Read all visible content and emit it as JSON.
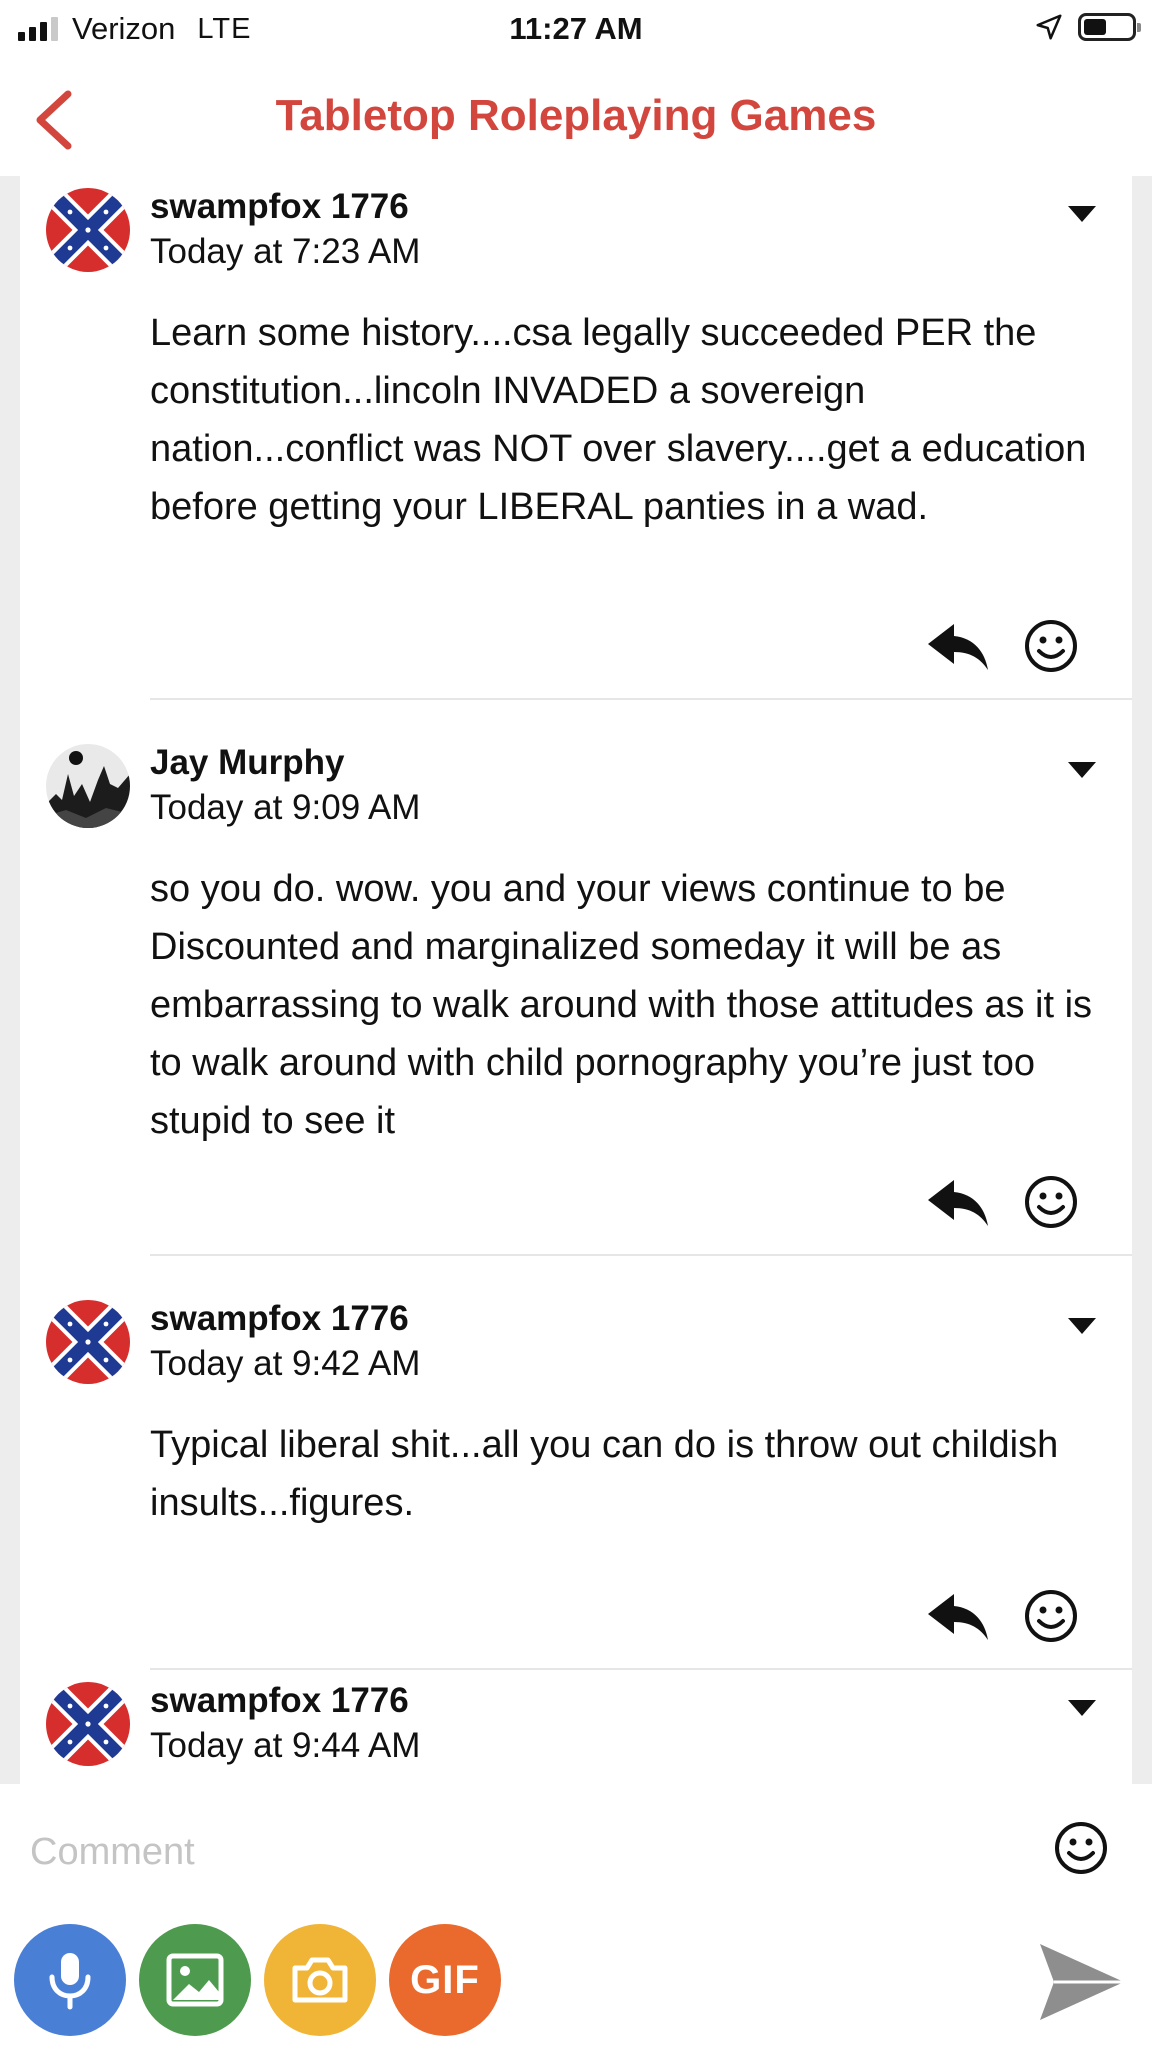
{
  "status_bar": {
    "carrier": "Verizon",
    "network": "LTE",
    "time": "11:27 AM",
    "signal_bars": 3,
    "battery_level": 0.45
  },
  "nav": {
    "title": "Tabletop Roleplaying Games",
    "back_icon": "chevron-left-icon",
    "accent_color": "#d2463d"
  },
  "comments": [
    {
      "author": "swampfox 1776",
      "time": "Today at 7:23 AM",
      "avatar": "confederate-flag-avatar",
      "text": "Learn some history....csa legally succeeded PER the constitution...lincoln INVADED a sovereign nation...conflict was NOT over slavery....get a education before getting your LIBERAL panties in a wad."
    },
    {
      "author": "Jay Murphy",
      "time": "Today at 9:09 AM",
      "avatar": "dark-landscape-avatar",
      "text": "so you do. wow. you and your views continue to be Discounted and marginalized someday it will be as embarrassing to walk around with those attitudes as it is to walk around with child pornography you’re just too stupid to see it"
    },
    {
      "author": "swampfox 1776",
      "time": "Today at 9:42 AM",
      "avatar": "confederate-flag-avatar",
      "text": "Typical liberal shit...all you can do is throw out childish insults...figures."
    },
    {
      "author": "swampfox 1776",
      "time": "Today at 9:44 AM",
      "avatar": "confederate-flag-avatar",
      "text": ""
    }
  ],
  "composer": {
    "placeholder": "Comment",
    "value": "",
    "gif_label": "GIF",
    "buttons": [
      {
        "name": "microphone",
        "color": "#4a7fd6"
      },
      {
        "name": "image",
        "color": "#4e9a4e"
      },
      {
        "name": "camera",
        "color": "#f0b437"
      },
      {
        "name": "gif",
        "color": "#ea6a2e"
      }
    ]
  }
}
